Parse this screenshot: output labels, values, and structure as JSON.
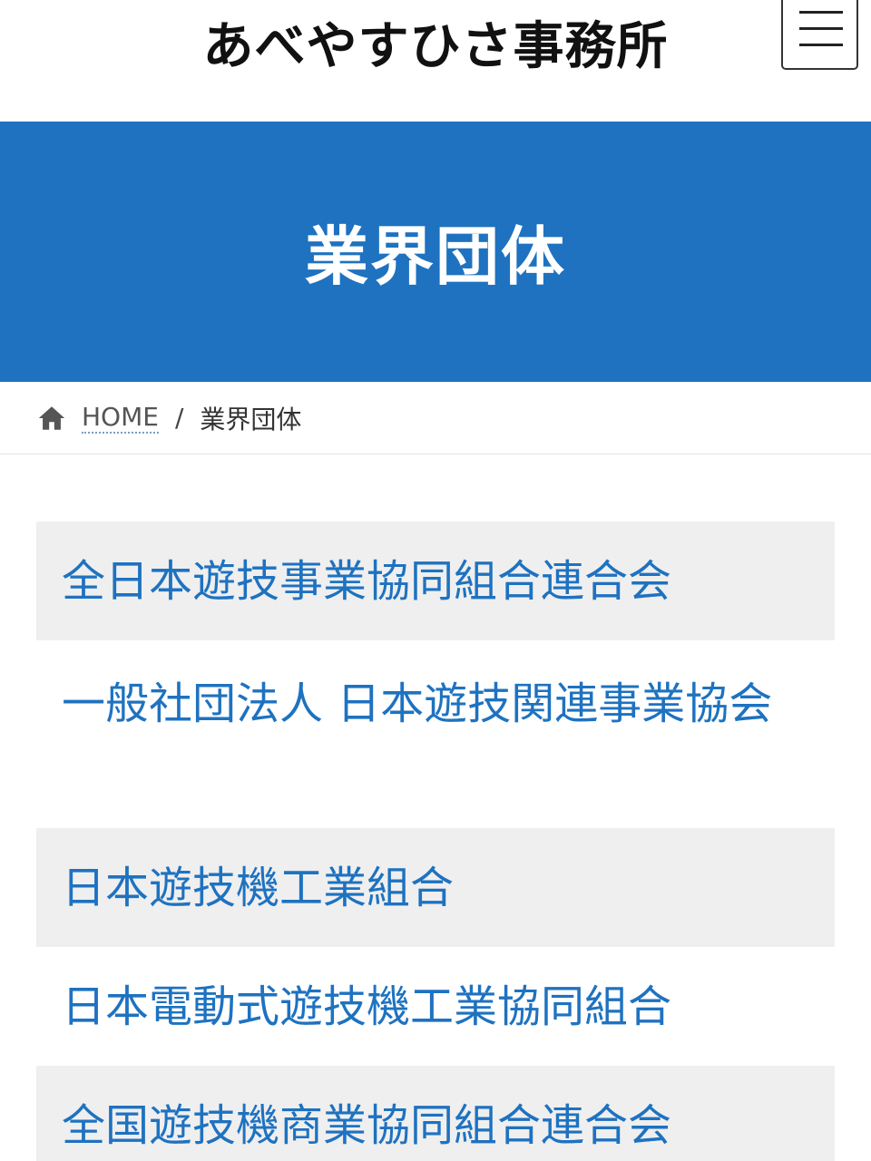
{
  "header": {
    "site_title": "あべやすひさ事務所"
  },
  "hero": {
    "title": "業界団体"
  },
  "breadcrumb": {
    "home_label": "HOME",
    "separator": "/",
    "current": "業界団体"
  },
  "organizations": [
    {
      "name": "全日本遊技事業協同組合連合会"
    },
    {
      "name": "一般社団法人 日本遊技関連事業協会"
    },
    {
      "name": "日本遊技機工業組合"
    },
    {
      "name": "日本電動式遊技機工業協同組合"
    },
    {
      "name": "全国遊技機商業協同組合連合会"
    }
  ],
  "colors": {
    "accent": "#1e72c0",
    "row_shade": "#efefef"
  }
}
